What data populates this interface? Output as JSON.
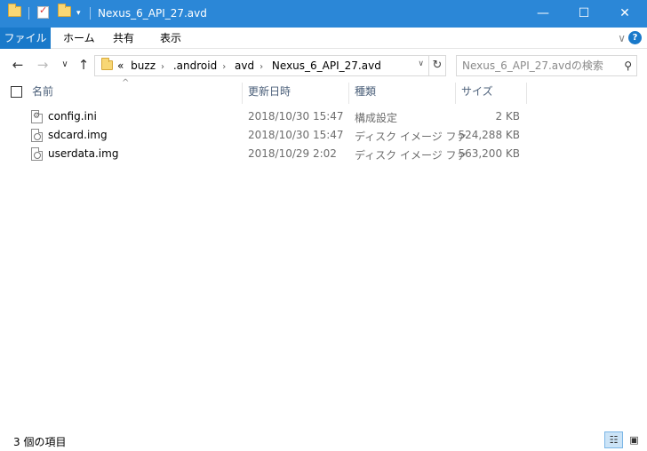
{
  "window": {
    "title": "Nexus_6_API_27.avd",
    "minimize_glyph": "—",
    "maximize_glyph": "☐",
    "close_glyph": "✕"
  },
  "quick_access": {
    "dropdown_glyph": "▾"
  },
  "ribbon": {
    "tabs": [
      {
        "label": "ファイル"
      },
      {
        "label": "ホーム"
      },
      {
        "label": "共有"
      },
      {
        "label": "表示"
      }
    ],
    "expand_glyph": "∨",
    "help_glyph": "?"
  },
  "nav": {
    "back_glyph": "←",
    "forward_glyph": "→",
    "recent_glyph": "∨",
    "up_glyph": "↑"
  },
  "address": {
    "overflow": "«",
    "crumbs": [
      "buzz",
      ".android",
      "avd",
      "Nexus_6_API_27.avd"
    ],
    "separator": "›",
    "dropdown_glyph": "∨",
    "refresh_glyph": "↻"
  },
  "search": {
    "placeholder": "Nexus_6_API_27.avdの検索",
    "icon": "search-icon",
    "glyph": "⚲"
  },
  "columns": {
    "sort_glyph": "^",
    "name": "名前",
    "date": "更新日時",
    "type": "種類",
    "size": "サイズ"
  },
  "files": [
    {
      "name": "config.ini",
      "date": "2018/10/30 15:47",
      "type": "構成設定",
      "size": "2 KB",
      "icon": "settings-file-icon"
    },
    {
      "name": "sdcard.img",
      "date": "2018/10/30 15:47",
      "type": "ディスク イメージ ファ",
      "size": "524,288 KB",
      "icon": "disk-image-icon"
    },
    {
      "name": "userdata.img",
      "date": "2018/10/29 2:02",
      "type": "ディスク イメージ ファ",
      "size": "563,200 KB",
      "icon": "disk-image-icon"
    }
  ],
  "status": {
    "item_count": "3 個の項目",
    "details_glyph": "☷",
    "thumbnail_glyph": "▣"
  },
  "colors": {
    "titlebar": "#2b87d7",
    "file_tab": "#1979ca",
    "header_text": "#4c607a"
  }
}
